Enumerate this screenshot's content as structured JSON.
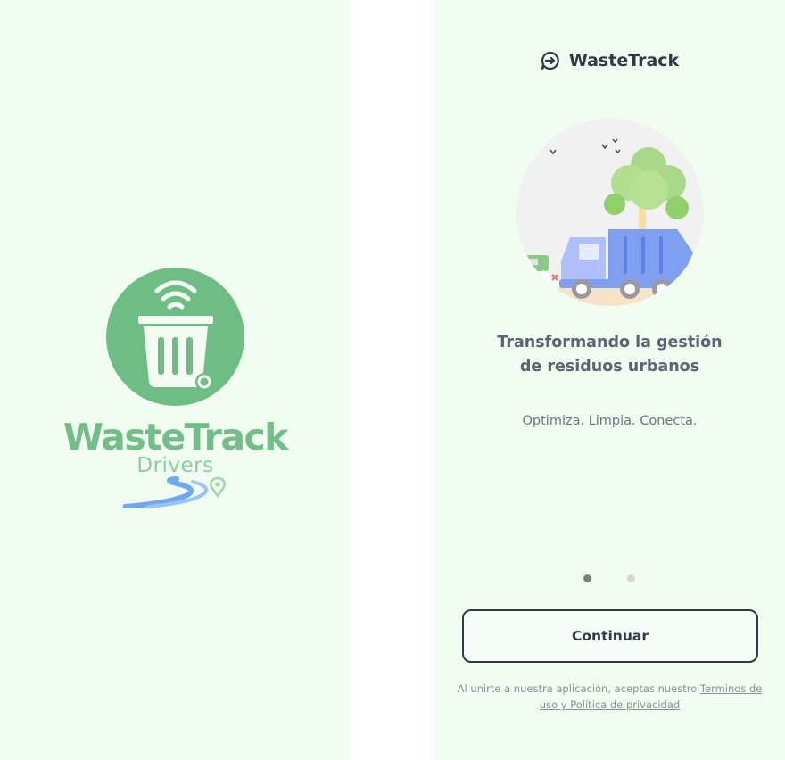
{
  "splash": {
    "logo_wordmark": "WasteTrack",
    "logo_subtitle": "Drivers",
    "colors": {
      "background": "#f1fdf1",
      "logo_green": "#6dbd84",
      "road_blue": "#6fa8f0"
    }
  },
  "onboarding": {
    "brand": {
      "icon": "chat-arrow-logo-icon",
      "name": "WasteTrack"
    },
    "illustration": "garbage-truck-tree-illustration",
    "headline_line1": "Transformando la gestión",
    "headline_line2": "de residuos urbanos",
    "tagline": "Optimiza. Limpia. Conecta.",
    "pager": {
      "current": 1,
      "total": 2
    },
    "continue_label": "Continuar",
    "legal": {
      "prefix": "Al unirte a nuestra aplicación, aceptas nuestro ",
      "link_text": "Terminos de uso y Política de privacidad"
    },
    "colors": {
      "background": "#f1fdf1",
      "text_dark": "#2f3a45",
      "headline": "#5a6573"
    }
  }
}
